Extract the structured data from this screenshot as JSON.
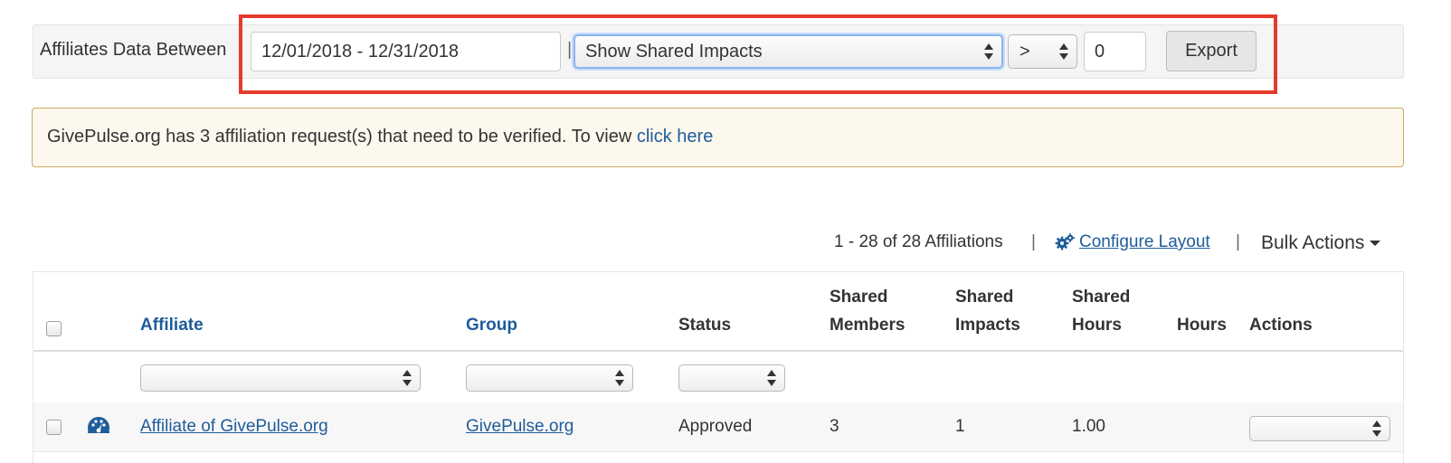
{
  "filter": {
    "label": "Affiliates Data Between",
    "date_range": "12/01/2018 - 12/31/2018",
    "separator": "|",
    "impact_select": "Show Shared Impacts",
    "operator_select": ">",
    "threshold_value": "0",
    "export_label": "Export",
    "highlight_color": "#e43b2c"
  },
  "alert": {
    "message": "GivePulse.org has 3 affiliation request(s) that need to be verified. To view",
    "link_text": "click here"
  },
  "toolbar": {
    "pager": "1 - 28 of 28 Affiliations",
    "separator": "|",
    "configure_label": "Configure Layout",
    "configure_icon": "gears-icon",
    "bulk_actions_label": "Bulk Actions"
  },
  "table": {
    "headers": {
      "affiliate": "Affiliate",
      "group": "Group",
      "status": "Status",
      "shared_members_1": "Shared",
      "shared_members_2": "Members",
      "shared_impacts_1": "Shared",
      "shared_impacts_2": "Impacts",
      "shared_hours_1": "Shared",
      "shared_hours_2": "Hours",
      "hours": "Hours",
      "actions": "Actions"
    },
    "rows": [
      {
        "icon": "dashboard-gauge-icon",
        "affiliate": "Affiliate of GivePulse.org",
        "group": "GivePulse.org",
        "status": "Approved",
        "shared_members": "3",
        "shared_impacts": "1",
        "shared_hours": "1.00",
        "hours": ""
      }
    ]
  },
  "colors": {
    "link": "#1f5c9a",
    "alert_bg": "#fcf8ed",
    "alert_border": "#c9a864"
  }
}
